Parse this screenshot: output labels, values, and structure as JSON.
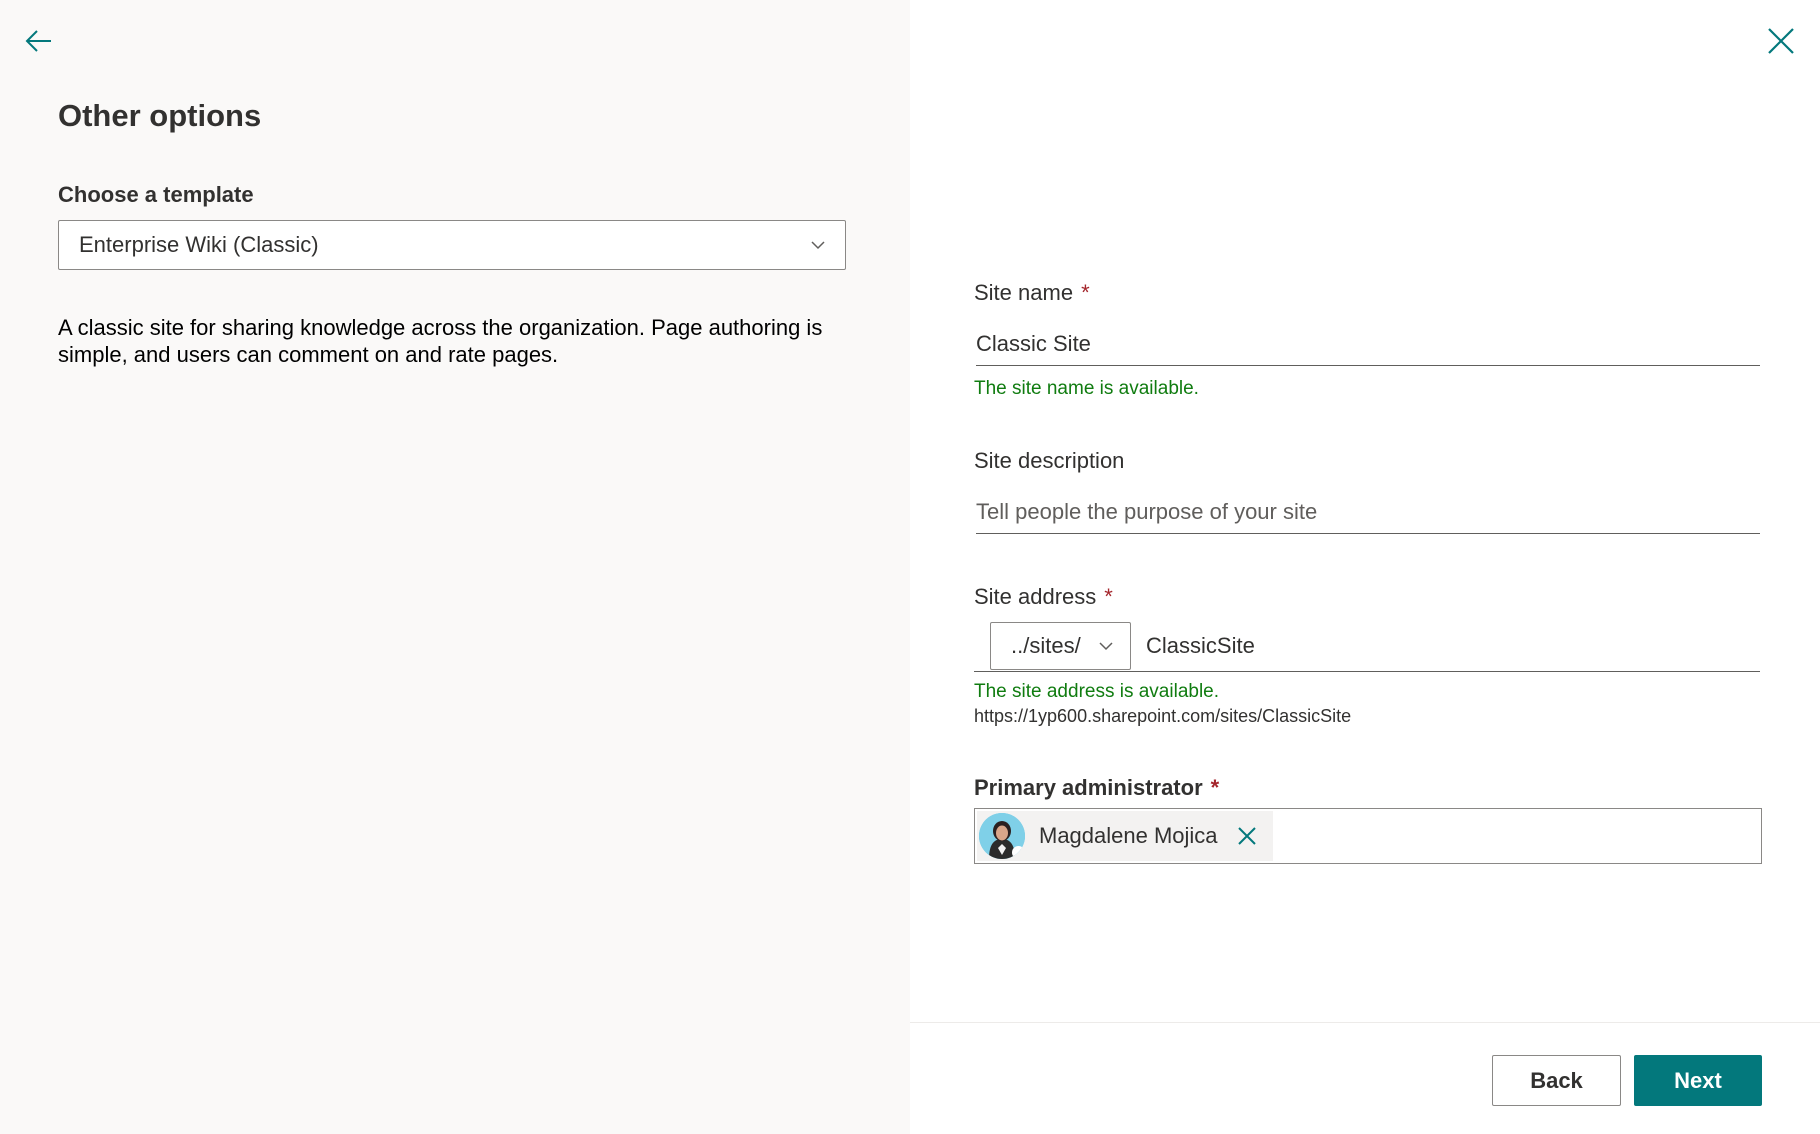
{
  "left_panel": {
    "title": "Other options",
    "template_label": "Choose a template",
    "template_selected": "Enterprise Wiki (Classic)",
    "template_description": "A classic site for sharing knowledge across the organization. Page authoring is simple, and users can comment on and rate pages."
  },
  "form": {
    "site_name": {
      "label": "Site name",
      "required_mark": "*",
      "value": "Classic Site",
      "status": "The site name is available."
    },
    "site_description": {
      "label": "Site description",
      "placeholder": "Tell people the purpose of your site",
      "value": ""
    },
    "site_address": {
      "label": "Site address",
      "required_mark": "*",
      "prefix": "../sites/",
      "value": "ClassicSite",
      "status": "The site address is available.",
      "full_url": "https://1yp600.sharepoint.com/sites/ClassicSite"
    },
    "primary_admin": {
      "label": "Primary administrator",
      "required_mark": "*",
      "person_name": "Magdalene Mojica"
    }
  },
  "footer": {
    "back_label": "Back",
    "next_label": "Next"
  },
  "colors": {
    "accent": "#03787c",
    "success": "#107c10",
    "required": "#a4262c",
    "left_bg": "#faf9f8"
  },
  "icons": {
    "back": "back-arrow-icon",
    "close": "close-icon",
    "dropdown": "chevron-down-icon",
    "remove": "remove-icon"
  }
}
